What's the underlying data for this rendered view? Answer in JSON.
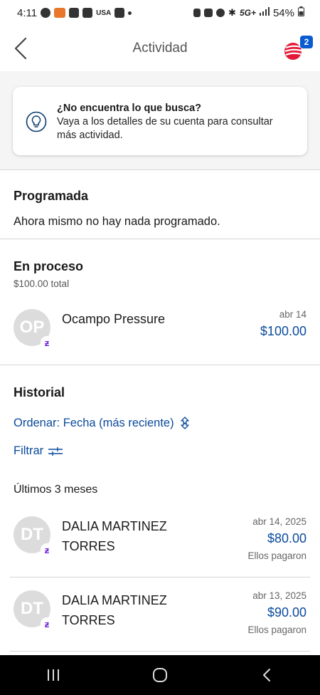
{
  "status_bar": {
    "time": "4:11",
    "carrier_tag": "USA",
    "network": "5G+",
    "battery": "54%"
  },
  "header": {
    "title": "Actividad",
    "badge_count": "2",
    "icons": {
      "back": "chevron-left-icon",
      "logo": "bank-logo-icon"
    }
  },
  "tip": {
    "title": "¿No encuentra lo que busca?",
    "body": "Vaya a los detalles de su cuenta para consultar más actividad.",
    "icon": "lightbulb-icon"
  },
  "scheduled": {
    "title": "Programada",
    "empty_text": "Ahora mismo no hay nada programado."
  },
  "in_process": {
    "title": "En proceso",
    "total": "$100.00 total",
    "items": [
      {
        "initials": "OP",
        "name": "Ocampo Pressure",
        "date": "abr 14",
        "amount": "$100.00"
      }
    ]
  },
  "history": {
    "title": "Historial",
    "sort_label": "Ordenar: Fecha (más reciente)",
    "filter_label": "Filtrar",
    "period_label": "Últimos 3 meses",
    "items": [
      {
        "initials": "DT",
        "name_line1": "DALIA MARTINEZ",
        "name_line2": "TORRES",
        "date": "abr 14, 2025",
        "amount": "$80.00",
        "status": "Ellos pagaron"
      },
      {
        "initials": "DT",
        "name_line1": "DALIA MARTINEZ",
        "name_line2": "TORRES",
        "date": "abr 13, 2025",
        "amount": "$90.00",
        "status": "Ellos pagaron"
      }
    ]
  },
  "colors": {
    "link_blue": "#0a4a9c",
    "badge_blue": "#0a5ad2",
    "zelle_purple": "#6d1ed4",
    "logo_red": "#e31837"
  }
}
